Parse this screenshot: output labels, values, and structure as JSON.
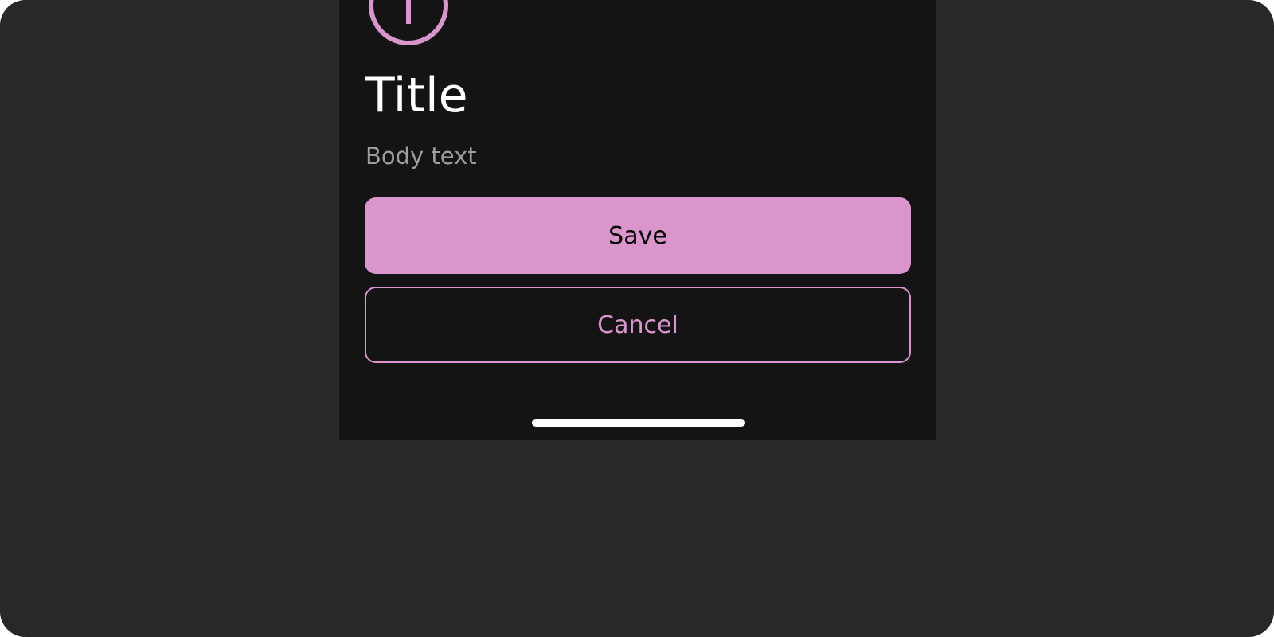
{
  "dialog": {
    "icon": "info-icon",
    "title": "Title",
    "body": "Body text"
  },
  "actions": {
    "save_label": "Save",
    "cancel_label": "Cancel"
  },
  "colors": {
    "backdrop": "#282828",
    "surface": "#141415",
    "accent": "#da95cc",
    "title_text": "#ffffff",
    "body_text": "#9e9e9e"
  }
}
